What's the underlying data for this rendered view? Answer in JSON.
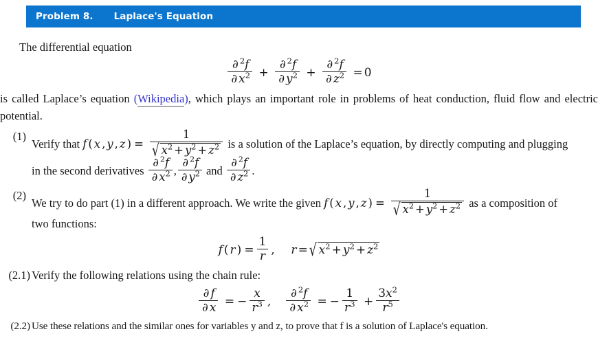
{
  "header": {
    "problem_label": "Problem 8.",
    "title": "Laplace's Equation",
    "bar_color": "#0C76CE",
    "text_color": "#FFFFFF"
  },
  "intro": {
    "lead_text": "The differential equation",
    "display_equation": {
      "terms": [
        {
          "numerator": "∂²f",
          "denominator": "∂x²"
        },
        {
          "numerator": "∂²f",
          "denominator": "∂y²"
        },
        {
          "numerator": "∂²f",
          "denominator": "∂z²"
        }
      ],
      "operators": [
        "+",
        "+"
      ],
      "relation": "=",
      "rhs": "0",
      "plain": "∂2f/∂x2 + ∂2f/∂y2 + ∂2f/∂z2 = 0"
    },
    "after_eq_part1": "is called Laplace’s equation",
    "open_paren": "(",
    "link_text": "Wikipedia",
    "close_paren": ")",
    "link_color": "#3333CC",
    "after_eq_part2": ", which plays an important role in problems of heat conduction, fluid flow and electric potential."
  },
  "items": [
    {
      "label": "(1)",
      "line1_before": "Verify that",
      "fn_notation": "f (x, y, z) =",
      "fn_value_numerator": "1",
      "fn_value_denominator": "√x² + y² + z²",
      "line1_after": "is a solution of the Laplace’s equation, by directly computing and plugging",
      "line2_before": "in the second derivatives",
      "deriv1": "∂²f/∂x²",
      "deriv_comma": ",",
      "deriv2": "∂²f/∂y²",
      "deriv_and": "and",
      "deriv3": "∂²f/∂z²",
      "line2_end": "."
    },
    {
      "label": "(2)",
      "line1_before": "We try to do part (1) in a different approach. We write the given",
      "fn_notation": "f (x, y, z) =",
      "fn_value_numerator": "1",
      "fn_value_denominator": "√x² + y² + z²",
      "line1_after": "as a composition of",
      "line2": "two functions:",
      "display_equation": {
        "lhs": "f (r) =",
        "numerator": "1",
        "denominator": "r",
        "comma": ",",
        "second_lhs": "r =",
        "second_rhs": "√x² + y² + z²"
      }
    },
    {
      "label": "(2.1)",
      "text": "Verify the following relations using the chain rule:",
      "display_equation": {
        "first": {
          "lhs_num": "∂f",
          "lhs_den": "∂x",
          "relation": "=",
          "sign": "−",
          "rhs_num": "x",
          "rhs_den": "r³",
          "trailing": ","
        },
        "second": {
          "lhs_num": "∂²f",
          "lhs_den": "∂x²",
          "relation": "=",
          "sign": "−",
          "term1_num": "1",
          "term1_den": "r³",
          "operator": "+",
          "term2_num": "3x²",
          "term2_den": "r⁵"
        }
      }
    },
    {
      "label": "(2.2)",
      "text": "Use these relations and the similar ones for variables y and z, to prove that f is a solution of Laplace's equation.",
      "text_pre": "Use these relations and the similar ones for variables",
      "var_y": "y",
      "text_and": "and",
      "var_z": "z",
      "text_mid": ", to prove that",
      "var_f": "f",
      "text_post": "is a solution of Laplace's equation."
    }
  ]
}
